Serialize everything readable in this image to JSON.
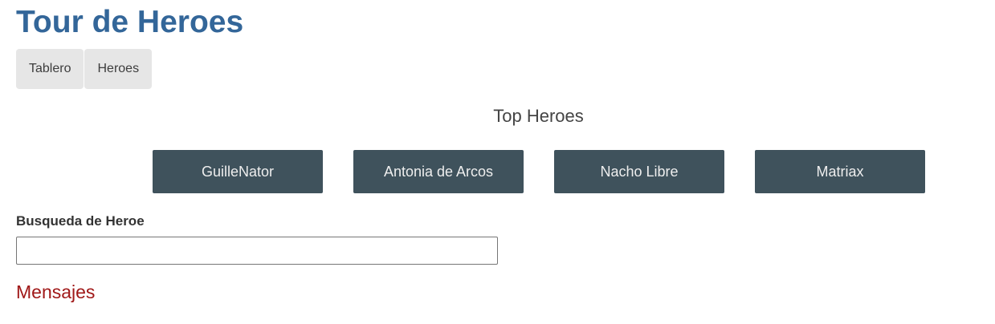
{
  "app": {
    "title": "Tour de Heroes"
  },
  "nav": {
    "items": [
      {
        "label": "Tablero"
      },
      {
        "label": "Heroes"
      }
    ]
  },
  "dashboard": {
    "title": "Top Heroes",
    "heroes": [
      {
        "name": "GuilleNator"
      },
      {
        "name": "Antonia de Arcos"
      },
      {
        "name": "Nacho Libre"
      },
      {
        "name": "Matriax"
      }
    ]
  },
  "search": {
    "label": "Busqueda de Heroe",
    "value": "",
    "placeholder": ""
  },
  "messages": {
    "title": "Mensajes"
  },
  "colors": {
    "title": "#336699",
    "nav_bg": "#e6e6e6",
    "hero_card_bg": "#3f525c",
    "messages_title": "#a01818"
  }
}
